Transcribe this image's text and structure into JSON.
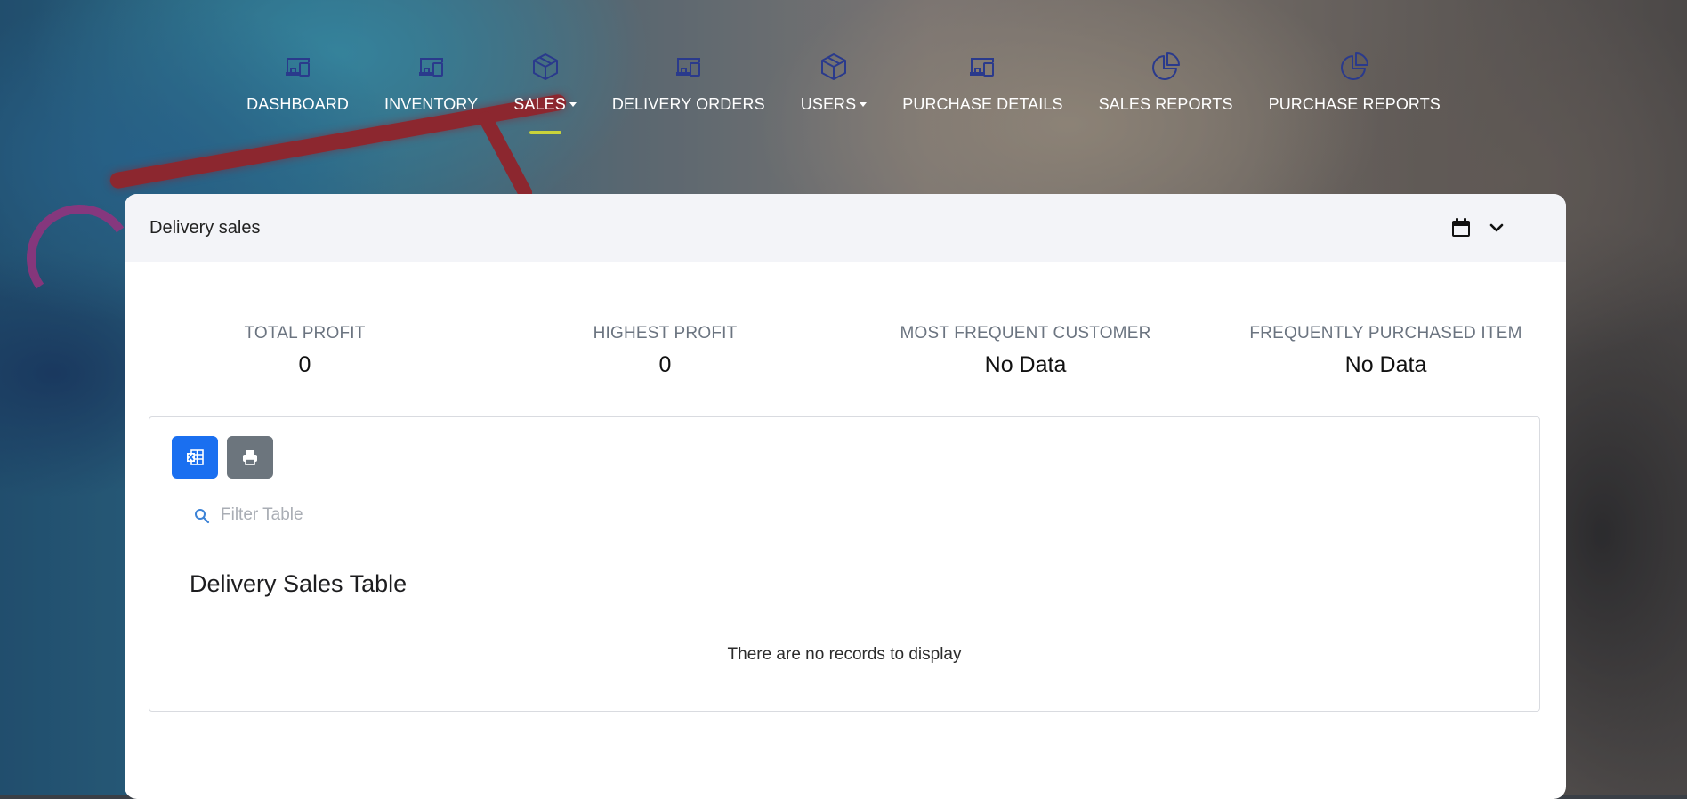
{
  "nav": {
    "items": [
      {
        "label": "DASHBOARD",
        "icon": "devices-icon"
      },
      {
        "label": "INVENTORY",
        "icon": "devices-icon"
      },
      {
        "label": "SALES",
        "icon": "box-icon"
      },
      {
        "label": "DELIVERY ORDERS",
        "icon": "devices-icon"
      },
      {
        "label": "USERS",
        "icon": "box-icon"
      },
      {
        "label": "PURCHASE DETAILS",
        "icon": "devices-icon"
      },
      {
        "label": "SALES REPORTS",
        "icon": "pie-chart-icon"
      },
      {
        "label": "PURCHASE REPORTS",
        "icon": "pie-chart-icon"
      }
    ],
    "active": "SALES",
    "accent_color": "#c9d33a",
    "icon_color": "#2a3a8c"
  },
  "card": {
    "title": "Delivery sales"
  },
  "stats": [
    {
      "label": "TOTAL PROFIT",
      "value": "0"
    },
    {
      "label": "HIGHEST PROFIT",
      "value": "0"
    },
    {
      "label": "MOST FREQUENT CUSTOMER",
      "value": "No Data"
    },
    {
      "label": "FREQUENTLY PURCHASED ITEM",
      "value": "No Data"
    }
  ],
  "table": {
    "filter_placeholder": "Filter Table",
    "title": "Delivery Sales Table",
    "empty_message": "There are no records to display",
    "export_button_color": "#1a6ff0",
    "print_button_color": "#6c757d"
  }
}
